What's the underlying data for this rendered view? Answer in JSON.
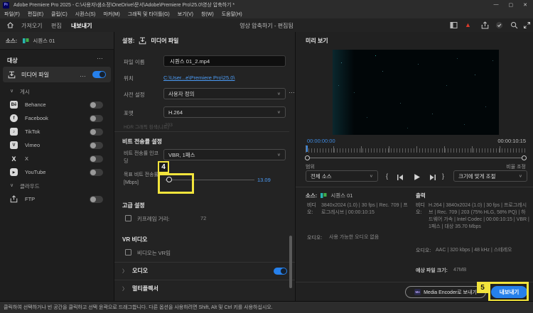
{
  "icons": {
    "minimize": "—",
    "maximize": "▢",
    "close": "✕",
    "ellipsis": "…",
    "chevron_down": "∨",
    "chevron_right": "〉",
    "app_badge": "Pr",
    "me_badge": "Me",
    "warning": "▲",
    "behance_glyph": "Bē",
    "facebook_glyph": "f",
    "tiktok_glyph": "♪",
    "vimeo_glyph": "V",
    "x_glyph": "X",
    "youtube_glyph": "▶",
    "brace_in": "{",
    "brace_out": "}"
  },
  "window": {
    "title": "Adobe Premiere Pro 2025 - C:\\사용자\\샘소정\\OneDrive\\문서\\Adobe\\Premiere Pro\\25.0\\영상 압축하기 *"
  },
  "menu_bar": {
    "items": [
      "파일(F)",
      "편집(E)",
      "클립(C)",
      "시퀀스(S)",
      "마커(M)",
      "그래픽 및 타이틀(G)",
      "보기(V)",
      "창(W)",
      "도움말(H)"
    ]
  },
  "app_header": {
    "tabs": [
      {
        "label": "가져오기"
      },
      {
        "label": "편집"
      },
      {
        "label": "내보내기"
      }
    ],
    "project_title": "영상 압축하기 - 편집됨"
  },
  "sidebar": {
    "source_label": "소스:",
    "source_name": "시퀀스 01",
    "destination_header": "대상",
    "media_file_label": "미디어 파일",
    "publish_header": "게시",
    "publish_items": [
      {
        "label": "Behance"
      },
      {
        "label": "Facebook"
      },
      {
        "label": "TikTok"
      },
      {
        "label": "Vimeo"
      },
      {
        "label": "X"
      },
      {
        "label": "YouTube"
      }
    ],
    "cloud_header": "클라우드",
    "ftp_label": "FTP"
  },
  "settings": {
    "header_label": "설정:",
    "header_name": "미디어 파일",
    "file_name_label": "파일 이름",
    "file_name_value": "시퀀스 01_2.mp4",
    "location_label": "위치",
    "location_value": "C:\\User...e\\Premiere Pro\\25.0\\",
    "preset_label": "사전 설정",
    "preset_value": "사용자 정의",
    "format_label": "포맷",
    "format_value": "H.264",
    "clipped_row_label": "HDR 그래픽 흰색(니트)",
    "clipped_row_value": "203",
    "bitrate_header": "비트 전송률 설정",
    "encoding_label": "비트 전송률 인코딩",
    "encoding_value": "VBR, 1패스",
    "target_label": "목표 비트 전송률[Mbps]",
    "target_value": "13.09",
    "advanced_header": "고급 설정",
    "keyframe_label": "키프레임 거리:",
    "keyframe_value": "72",
    "vr_header": "VR 비디오",
    "vr_checkbox_label": "비디오는 VR임",
    "audio_section_label": "오디오",
    "multiplexer_section_label": "멀티플렉서"
  },
  "preview": {
    "header": "미리 보기",
    "timecode_current": "00:00:00:00",
    "timecode_duration": "00:00:10:15",
    "range_label": "범위",
    "range_value": "전체 소스",
    "scale_label": "비율 조정",
    "scale_value": "크기에 맞게 조절",
    "source_info": {
      "label": "소스:",
      "name": "시퀀스 01",
      "video_label": "비디오:",
      "video_info": "3840x2024 (1.0) | 30 fps | Rec. 709 | 프로그레시브 | 00:00:10:15",
      "audio_label": "오디오:",
      "audio_info": "사용 가능한 오디오 없음"
    },
    "output_info": {
      "header": "출력",
      "video_label": "비디오:",
      "video_info": "H.264 | 3840x2024 (1.0) | 30 fps | 프로그레시브 | Rec. 709 | 203 (75% HLG, 58% PQ) | 하드웨어 가속 | Intel Codec | 00:00:10:15 | VBR | 1패스 | 대상 35.70 Mbps",
      "audio_label": "오디오:",
      "audio_info": "AAC | 320 kbps | 48 kHz | 스테레오",
      "size_label": "예상 파일 크기:",
      "size_value": "47MB"
    }
  },
  "footer": {
    "me_button_label": "Media Encoder로 보내기",
    "export_button_label": "내보내기"
  },
  "annotations": {
    "step4": "4",
    "step5": "5"
  },
  "status_bar": {
    "text": "클릭하여 선택하거나 빈 공간을 클릭하고 선택 윤곽으로 드래그합니다. 다른 옵션을 사용하려면 Shift, Alt 및 Ctrl 키를 사용하십시오."
  },
  "colors": {
    "accent": "#2680eb",
    "link": "#4b9bf5",
    "annotation_yellow": "#f2e43c",
    "warning_red": "#d93a2b",
    "timecode_blue": "#3f8ae0"
  }
}
